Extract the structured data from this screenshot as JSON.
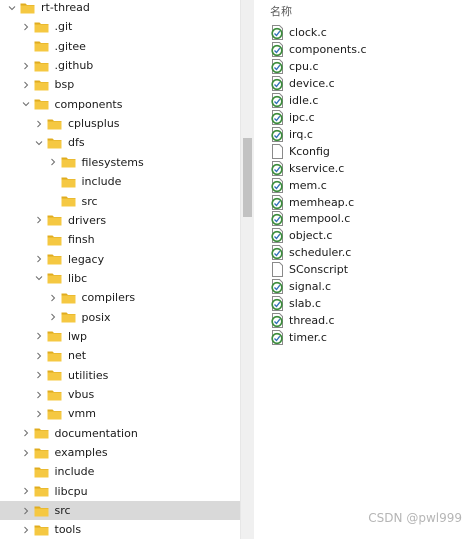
{
  "tree": [
    {
      "label": "rt-thread",
      "indent": 0,
      "chevron": "down",
      "selected": false
    },
    {
      "label": ".git",
      "indent": 1,
      "chevron": "right",
      "selected": false
    },
    {
      "label": ".gitee",
      "indent": 1,
      "chevron": "none",
      "selected": false
    },
    {
      "label": ".github",
      "indent": 1,
      "chevron": "right",
      "selected": false
    },
    {
      "label": "bsp",
      "indent": 1,
      "chevron": "right",
      "selected": false
    },
    {
      "label": "components",
      "indent": 1,
      "chevron": "down",
      "selected": false
    },
    {
      "label": "cplusplus",
      "indent": 2,
      "chevron": "right",
      "selected": false
    },
    {
      "label": "dfs",
      "indent": 2,
      "chevron": "down",
      "selected": false
    },
    {
      "label": "filesystems",
      "indent": 3,
      "chevron": "right",
      "selected": false
    },
    {
      "label": "include",
      "indent": 3,
      "chevron": "none",
      "selected": false
    },
    {
      "label": "src",
      "indent": 3,
      "chevron": "none",
      "selected": false
    },
    {
      "label": "drivers",
      "indent": 2,
      "chevron": "right",
      "selected": false
    },
    {
      "label": "finsh",
      "indent": 2,
      "chevron": "none",
      "selected": false
    },
    {
      "label": "legacy",
      "indent": 2,
      "chevron": "right",
      "selected": false
    },
    {
      "label": "libc",
      "indent": 2,
      "chevron": "down",
      "selected": false
    },
    {
      "label": "compilers",
      "indent": 3,
      "chevron": "right",
      "selected": false
    },
    {
      "label": "posix",
      "indent": 3,
      "chevron": "right",
      "selected": false
    },
    {
      "label": "lwp",
      "indent": 2,
      "chevron": "right",
      "selected": false
    },
    {
      "label": "net",
      "indent": 2,
      "chevron": "right",
      "selected": false
    },
    {
      "label": "utilities",
      "indent": 2,
      "chevron": "right",
      "selected": false
    },
    {
      "label": "vbus",
      "indent": 2,
      "chevron": "right",
      "selected": false
    },
    {
      "label": "vmm",
      "indent": 2,
      "chevron": "right",
      "selected": false
    },
    {
      "label": "documentation",
      "indent": 1,
      "chevron": "right",
      "selected": false
    },
    {
      "label": "examples",
      "indent": 1,
      "chevron": "right",
      "selected": false
    },
    {
      "label": "include",
      "indent": 1,
      "chevron": "none",
      "selected": false
    },
    {
      "label": "libcpu",
      "indent": 1,
      "chevron": "right",
      "selected": false
    },
    {
      "label": "src",
      "indent": 1,
      "chevron": "right",
      "selected": true
    },
    {
      "label": "tools",
      "indent": 1,
      "chevron": "right",
      "selected": false
    }
  ],
  "file_list": {
    "column_header": "名称",
    "files": [
      {
        "name": "clock.c",
        "icon": "c-source-icon"
      },
      {
        "name": "components.c",
        "icon": "c-source-icon"
      },
      {
        "name": "cpu.c",
        "icon": "c-source-icon"
      },
      {
        "name": "device.c",
        "icon": "c-source-icon"
      },
      {
        "name": "idle.c",
        "icon": "c-source-icon"
      },
      {
        "name": "ipc.c",
        "icon": "c-source-icon"
      },
      {
        "name": "irq.c",
        "icon": "c-source-icon"
      },
      {
        "name": "Kconfig",
        "icon": "blank-file-icon"
      },
      {
        "name": "kservice.c",
        "icon": "c-source-icon"
      },
      {
        "name": "mem.c",
        "icon": "c-source-icon"
      },
      {
        "name": "memheap.c",
        "icon": "c-source-icon"
      },
      {
        "name": "mempool.c",
        "icon": "c-source-icon"
      },
      {
        "name": "object.c",
        "icon": "c-source-icon"
      },
      {
        "name": "scheduler.c",
        "icon": "c-source-icon"
      },
      {
        "name": "SConscript",
        "icon": "blank-file-icon"
      },
      {
        "name": "signal.c",
        "icon": "c-source-icon"
      },
      {
        "name": "slab.c",
        "icon": "c-source-icon"
      },
      {
        "name": "thread.c",
        "icon": "c-source-icon"
      },
      {
        "name": "timer.c",
        "icon": "c-source-icon"
      }
    ]
  },
  "watermark": "CSDN @pwl999",
  "colors": {
    "folder": "#f5c842",
    "folder_dark": "#e0ac1f",
    "selected_row": "#d9d9d9",
    "c_icon_ring": "#3b8c3b"
  }
}
